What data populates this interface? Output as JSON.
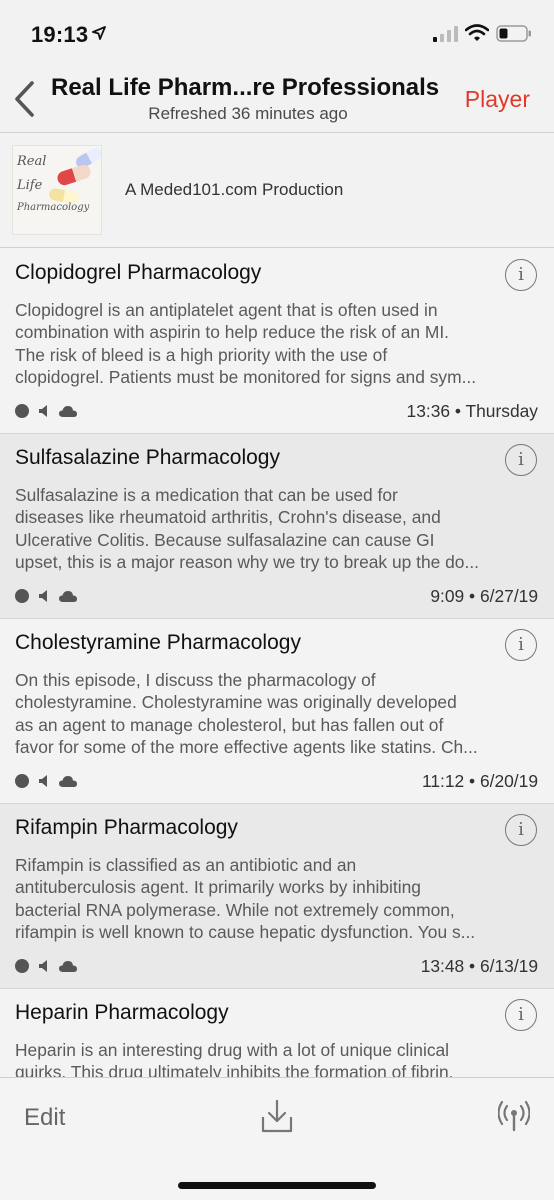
{
  "status_bar": {
    "time": "19:13"
  },
  "nav": {
    "title": "Real Life Pharm...re Professionals",
    "subtitle": "Refreshed 36 minutes ago",
    "player_label": "Player"
  },
  "podcast": {
    "artwork_text": [
      "Real",
      "Life",
      "Pharmacology"
    ],
    "production": "A Meded101.com Production"
  },
  "episodes": [
    {
      "title": "Clopidogrel Pharmacology",
      "description": [
        "Clopidogrel is an antiplatelet agent that is often used in",
        "combination with aspirin to help reduce the risk of an MI.",
        "The risk of bleed is a high priority with the use of",
        "clopidogrel. Patients must be monitored for signs and sym..."
      ],
      "meta": "13:36 • Thursday"
    },
    {
      "title": "Sulfasalazine Pharmacology",
      "description": [
        "Sulfasalazine is a medication that can be used for",
        "diseases like rheumatoid arthritis, Crohn's disease, and",
        "Ulcerative Colitis. Because sulfasalazine can cause GI",
        "upset, this is a major reason why we try to break up the do..."
      ],
      "meta": "9:09 • 6/27/19"
    },
    {
      "title": "Cholestyramine Pharmacology",
      "description": [
        "On this episode, I discuss the pharmacology of",
        "cholestyramine. Cholestyramine was originally developed",
        "as an agent to manage cholesterol, but has fallen out of",
        "favor for some of the more effective agents like statins. Ch..."
      ],
      "meta": "11:12 • 6/20/19"
    },
    {
      "title": "Rifampin Pharmacology",
      "description": [
        "Rifampin is classified as an antibiotic and an",
        "antituberculosis agent. It primarily works by inhibiting",
        "bacterial RNA polymerase. While not extremely common,",
        "rifampin is well known to cause hepatic dysfunction. You s..."
      ],
      "meta": "13:48 • 6/13/19"
    },
    {
      "title": "Heparin Pharmacology",
      "description": [
        "Heparin is an interesting drug with a lot of unique clinical",
        "quirks. This drug ultimately inhibits the formation of fibrin."
      ],
      "meta": ""
    }
  ],
  "toolbar": {
    "edit_label": "Edit"
  },
  "colors": {
    "accent": "#e0392c",
    "alt_row": "#e9e9e9"
  },
  "icons": [
    "location-arrow-icon",
    "signal-icon",
    "wifi-icon",
    "battery-icon",
    "back-chevron-icon",
    "info-icon",
    "played-dot-icon",
    "speaker-icon",
    "cloud-icon",
    "download-icon",
    "broadcast-icon"
  ]
}
